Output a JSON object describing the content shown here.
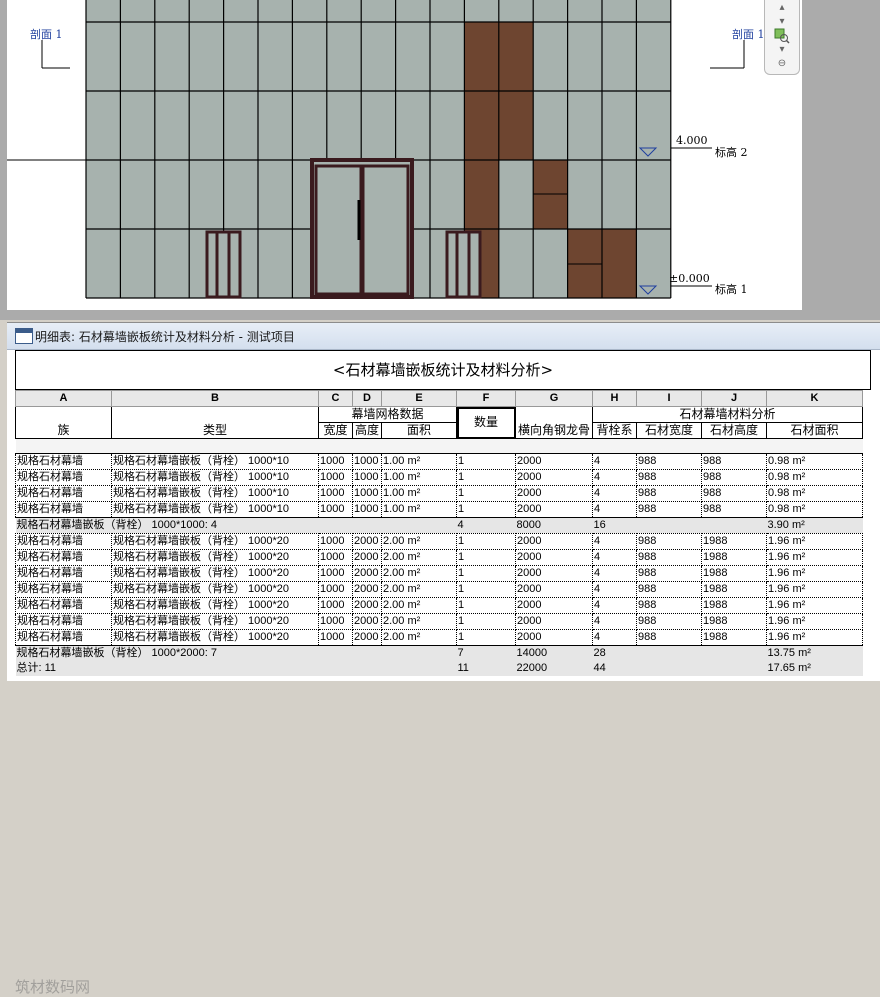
{
  "drawing": {
    "section_left": "剖面 1",
    "section_right": "剖面 1",
    "level_2": {
      "elevation": "4.000",
      "name": "标高 2"
    },
    "level_1": {
      "elevation": "±0.000",
      "name": "标高 1"
    }
  },
  "nav_bar": {
    "icons": [
      "nav-up-icon",
      "nav-down-icon",
      "zoom-region-icon",
      "nav-more-icon"
    ]
  },
  "schedule": {
    "window_title": "明细表: 石材幕墙嵌板统计及材料分析 - 测试项目",
    "title": "<石材幕墙嵌板统计及材料分析>",
    "letters": [
      "A",
      "B",
      "C",
      "D",
      "E",
      "F",
      "G",
      "H",
      "I",
      "J",
      "K"
    ],
    "group_curtain": "幕墙网格数据",
    "group_stone": "石材幕墙材料分析",
    "headers": {
      "A": "族",
      "B": "类型",
      "C": "宽度",
      "D": "高度",
      "E": "面积",
      "F": "数量",
      "G": "横向角钢龙骨",
      "H": "背栓系",
      "I": "石材宽度",
      "J": "石材高度",
      "K": "石材面积"
    },
    "groups": [
      {
        "rows": [
          [
            "规格石材幕墙",
            "规格石材幕墙嵌板（背栓） 1000*10",
            "1000",
            "1000",
            "1.00 m²",
            "1",
            "2000",
            "4",
            "988",
            "988",
            "0.98 m²"
          ],
          [
            "规格石材幕墙",
            "规格石材幕墙嵌板（背栓） 1000*10",
            "1000",
            "1000",
            "1.00 m²",
            "1",
            "2000",
            "4",
            "988",
            "988",
            "0.98 m²"
          ],
          [
            "规格石材幕墙",
            "规格石材幕墙嵌板（背栓） 1000*10",
            "1000",
            "1000",
            "1.00 m²",
            "1",
            "2000",
            "4",
            "988",
            "988",
            "0.98 m²"
          ],
          [
            "规格石材幕墙",
            "规格石材幕墙嵌板（背栓） 1000*10",
            "1000",
            "1000",
            "1.00 m²",
            "1",
            "2000",
            "4",
            "988",
            "988",
            "0.98 m²"
          ]
        ],
        "subtotal": {
          "label": "规格石材幕墙嵌板（背栓） 1000*1000: 4",
          "count": "4",
          "steel": "8000",
          "bolts": "16",
          "area": "3.90 m²"
        }
      },
      {
        "rows": [
          [
            "规格石材幕墙",
            "规格石材幕墙嵌板（背栓） 1000*20",
            "1000",
            "2000",
            "2.00 m²",
            "1",
            "2000",
            "4",
            "988",
            "1988",
            "1.96 m²"
          ],
          [
            "规格石材幕墙",
            "规格石材幕墙嵌板（背栓） 1000*20",
            "1000",
            "2000",
            "2.00 m²",
            "1",
            "2000",
            "4",
            "988",
            "1988",
            "1.96 m²"
          ],
          [
            "规格石材幕墙",
            "规格石材幕墙嵌板（背栓） 1000*20",
            "1000",
            "2000",
            "2.00 m²",
            "1",
            "2000",
            "4",
            "988",
            "1988",
            "1.96 m²"
          ],
          [
            "规格石材幕墙",
            "规格石材幕墙嵌板（背栓） 1000*20",
            "1000",
            "2000",
            "2.00 m²",
            "1",
            "2000",
            "4",
            "988",
            "1988",
            "1.96 m²"
          ],
          [
            "规格石材幕墙",
            "规格石材幕墙嵌板（背栓） 1000*20",
            "1000",
            "2000",
            "2.00 m²",
            "1",
            "2000",
            "4",
            "988",
            "1988",
            "1.96 m²"
          ],
          [
            "规格石材幕墙",
            "规格石材幕墙嵌板（背栓） 1000*20",
            "1000",
            "2000",
            "2.00 m²",
            "1",
            "2000",
            "4",
            "988",
            "1988",
            "1.96 m²"
          ],
          [
            "规格石材幕墙",
            "规格石材幕墙嵌板（背栓） 1000*20",
            "1000",
            "2000",
            "2.00 m²",
            "1",
            "2000",
            "4",
            "988",
            "1988",
            "1.96 m²"
          ]
        ],
        "subtotal": {
          "label": "规格石材幕墙嵌板（背栓） 1000*2000: 7",
          "count": "7",
          "steel": "14000",
          "bolts": "28",
          "area": "13.75 m²"
        }
      }
    ],
    "total": {
      "label": "总计: 11",
      "count": "11",
      "steel": "22000",
      "bolts": "44",
      "area": "17.65 m²"
    }
  },
  "watermark": "筑材数码网",
  "colors": {
    "glass": "#a7b2ae",
    "stone": "#6e4530",
    "frame": "#3a1a1e",
    "accent": "#1f3f9e",
    "title_bar": "#dbe4f0"
  }
}
